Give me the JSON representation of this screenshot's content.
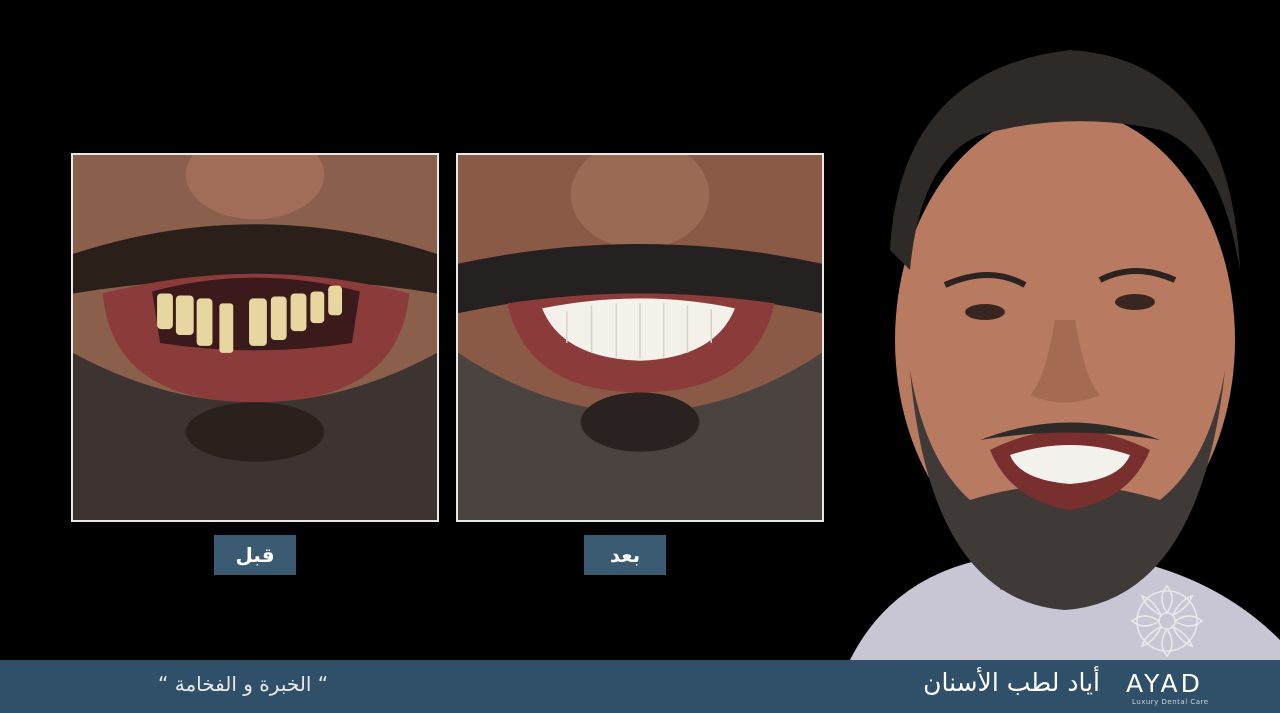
{
  "captions": {
    "before": "قبل",
    "after": "بعد"
  },
  "footer": {
    "slogan": "“ الخبرة و الفخامة “",
    "clinic_name_ar": "أياد لطب الأسنان",
    "logo_text": "AYAD",
    "logo_subtitle": "Luxury Dental Care"
  },
  "colors": {
    "background": "#000000",
    "caption_bg": "#3b5b73",
    "footer_bg": "#2f5068",
    "text": "#ffffff"
  },
  "icons": {
    "logo_mark": "floral-logo-icon"
  }
}
